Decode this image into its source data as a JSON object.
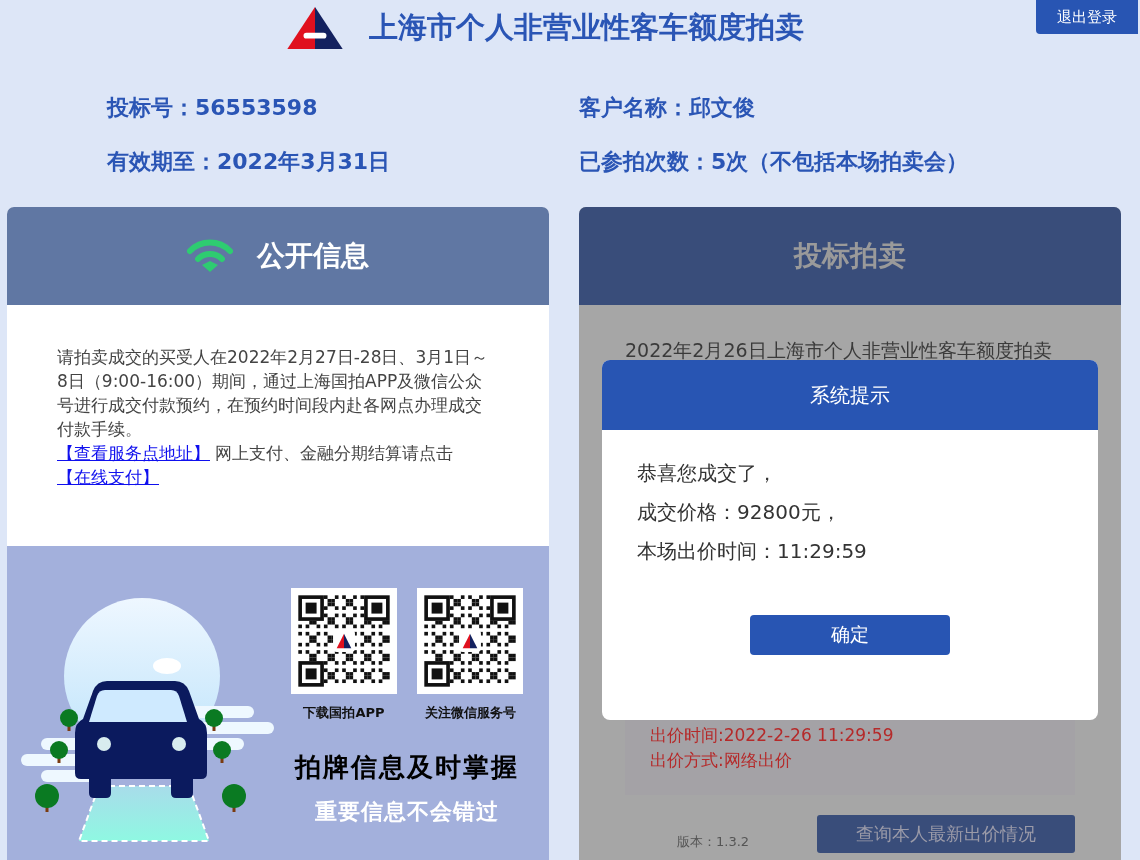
{
  "header": {
    "title": "上海市个人非营业性客车额度拍卖",
    "logout_button": "退出登录"
  },
  "account": {
    "fields": [
      "投标号：56553598",
      "客户名称：邱文俊",
      "有效期至：2022年3月31日",
      "已参拍次数：5次（不包括本场拍卖会）"
    ]
  },
  "public_info": {
    "title": "公开信息",
    "notice": "请拍卖成交的买受人在2022年2月27日-28日、3月1日～8日（9:00-16:00）期间，通过上海国拍APP及微信公众号进行成交付款预约，在预约时间段内赴各网点办理成交付款手续。",
    "payment_line": [
      {
        "kind": "link",
        "text": "【查看服务点地址】"
      },
      {
        "kind": "text",
        "text": " 网上支付、金融分期结算请点击"
      },
      {
        "kind": "link",
        "text": "【在线支付】"
      }
    ],
    "qr_codes": [
      "下载国拍APP",
      "关注微信服务号"
    ],
    "slogan": "拍牌信息及时掌握",
    "subslogan": "重要信息不会错过"
  },
  "bidding": {
    "title": "投标拍卖",
    "auction_title": "2022年2月26日上海市个人非营业性客车额度拍卖",
    "bid_lines": [
      "出价时间:2022-2-26 11:29:59",
      "出价方式:网络出价"
    ],
    "version": "版本：1.3.2",
    "query_button": "查询本人最新出价情况"
  },
  "dialog": {
    "title": "系统提示",
    "lines": [
      "恭喜您成交了，",
      "成交价格：92800元，",
      "本场出价时间：11:29:59"
    ],
    "confirm_button": "确定"
  }
}
